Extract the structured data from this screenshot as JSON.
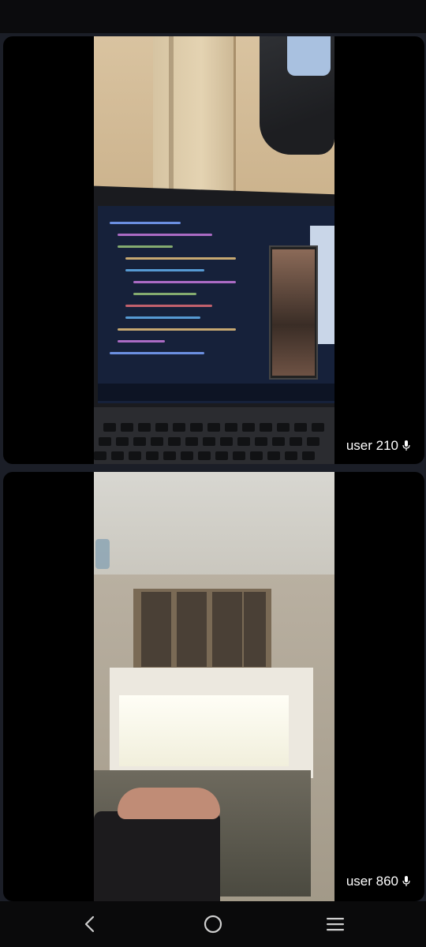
{
  "participants": [
    {
      "name": "user 210",
      "mic_icon": "microphone-icon",
      "muted": false
    },
    {
      "name": "user 860",
      "mic_icon": "microphone-icon",
      "muted": false
    }
  ],
  "navigation": {
    "back_icon": "chevron-left-icon",
    "home_icon": "circle-home-icon",
    "menu_icon": "hamburger-menu-icon"
  },
  "colors": {
    "background": "#1b1e27",
    "tile": "#000000",
    "label_text": "#ffffff"
  }
}
